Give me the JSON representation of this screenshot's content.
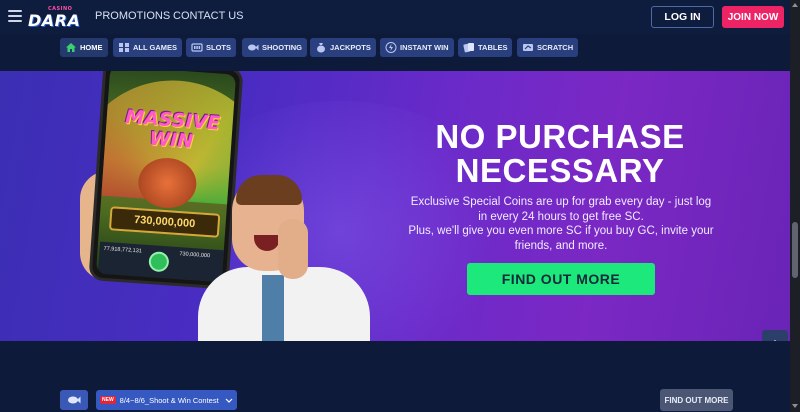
{
  "header": {
    "logo_small": "CASINO",
    "logo_main": "DARA",
    "nav": [
      "PROMOTIONS",
      "CONTACT US"
    ],
    "login_label": "LOG IN",
    "join_label": "JOIN NOW"
  },
  "categories": [
    {
      "label": "HOME",
      "icon": "home-icon"
    },
    {
      "label": "ALL GAMES",
      "icon": "grid-icon"
    },
    {
      "label": "SLOTS",
      "icon": "slot-machine-icon"
    },
    {
      "label": "SHOOTING",
      "icon": "fish-icon"
    },
    {
      "label": "JACKPOTS",
      "icon": "money-bag-icon"
    },
    {
      "label": "INSTANT WIN",
      "icon": "lightning-icon"
    },
    {
      "label": "TABLES",
      "icon": "cards-icon"
    },
    {
      "label": "SCRATCH",
      "icon": "scratch-card-icon"
    }
  ],
  "banner": {
    "headline_line1": "NO PURCHASE",
    "headline_line2": "NECESSARY",
    "sub_line1": "Exclusive Special Coins are up for grab every day - just log",
    "sub_line2": "in every 24 hours to get free SC.",
    "sub_line3": "Plus, we'll give you even more SC if you buy GC, invite your",
    "sub_line4": "friends, and more.",
    "cta_label": "FIND OUT MORE",
    "phone_game_text_1": "MASSIVE",
    "phone_game_text_2": "WIN",
    "phone_win_amount": "730,000,000",
    "phone_balance": "77,918,772,131",
    "phone_bet": "730,000,000"
  },
  "bottom": {
    "new_badge": "NEW",
    "contest_label": "8/4~8/6_Shoot & Win Contest",
    "find_label": "FIND OUT MORE"
  },
  "colors": {
    "header_bg": "#0e1c3d",
    "join_button": "#ec2466",
    "cta_green": "#1ce87c",
    "category_bg": "#2a3f7e",
    "banner_purple": "#6a2ac9"
  }
}
